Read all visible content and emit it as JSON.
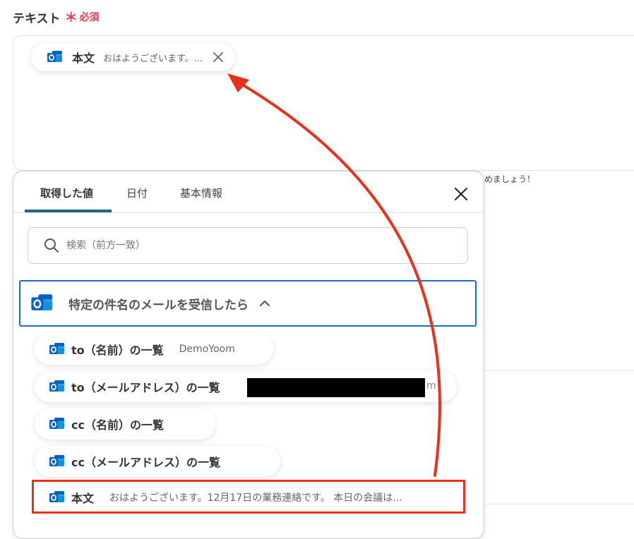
{
  "field": {
    "label": "テキスト",
    "required_mark": "＊",
    "required_text": "必須"
  },
  "chip": {
    "name": "本文",
    "value": "おはようございます。..."
  },
  "background": {
    "hint_text": "めましょう！"
  },
  "tabs": [
    {
      "label": "取得した値",
      "active": true
    },
    {
      "label": "日付",
      "active": false
    },
    {
      "label": "基本情報",
      "active": false
    }
  ],
  "search": {
    "placeholder": "検索（前方一致）"
  },
  "section": {
    "title": "特定の件名のメールを受信したら"
  },
  "items": [
    {
      "name": "to（名前）の一覧",
      "value": "DemoYoom"
    },
    {
      "name": "to（メールアドレス）の一覧",
      "value": "",
      "redacted_tail": "m"
    },
    {
      "name": "cc（名前）の一覧",
      "value": ""
    },
    {
      "name": "cc（メールアドレス）の一覧",
      "value": ""
    },
    {
      "name": "本文",
      "value": "おはようございます。12月17日の業務連絡です。 本日の会議は..."
    }
  ],
  "colors": {
    "required": "#e8394a",
    "tab_underline": "#1d6c7c",
    "section_border": "#1d6ec4",
    "annotation": "#e8321a",
    "outlook_blue": "#0a64c7"
  },
  "icons": {
    "app": "outlook-icon",
    "chip_close": "close-icon",
    "popup_close": "close-icon",
    "search": "search-icon",
    "section_toggle": "chevron-up-icon"
  }
}
